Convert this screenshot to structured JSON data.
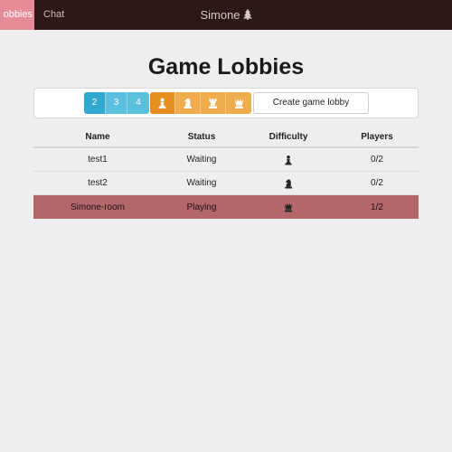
{
  "nav": {
    "lobbies_label": "obbies",
    "chat_label": "Chat",
    "username": "Simone"
  },
  "page": {
    "title": "Game Lobbies"
  },
  "toolbar": {
    "player_options": [
      "2",
      "3",
      "4"
    ],
    "selected_players": "2",
    "difficulty_icons": [
      "pawn-icon",
      "knight-icon",
      "rook-icon",
      "queen-icon"
    ],
    "selected_difficulty": "pawn-icon",
    "create_label": "Create game lobby",
    "colors": {
      "players": "#5bc0de",
      "difficulty": "#f0ad4e"
    }
  },
  "table": {
    "headers": {
      "name": "Name",
      "status": "Status",
      "difficulty": "Difficulty",
      "players": "Players"
    },
    "rows": [
      {
        "name": "test1",
        "status": "Waiting",
        "difficulty_icon": "pawn-icon",
        "players": "0/2"
      },
      {
        "name": "test2",
        "status": "Waiting",
        "difficulty_icon": "knight-icon",
        "players": "0/2"
      },
      {
        "name": "Simone-room",
        "status": "Playing",
        "difficulty_icon": "queen-icon",
        "players": "1/2"
      }
    ],
    "highlight_color": "#b3676a"
  }
}
